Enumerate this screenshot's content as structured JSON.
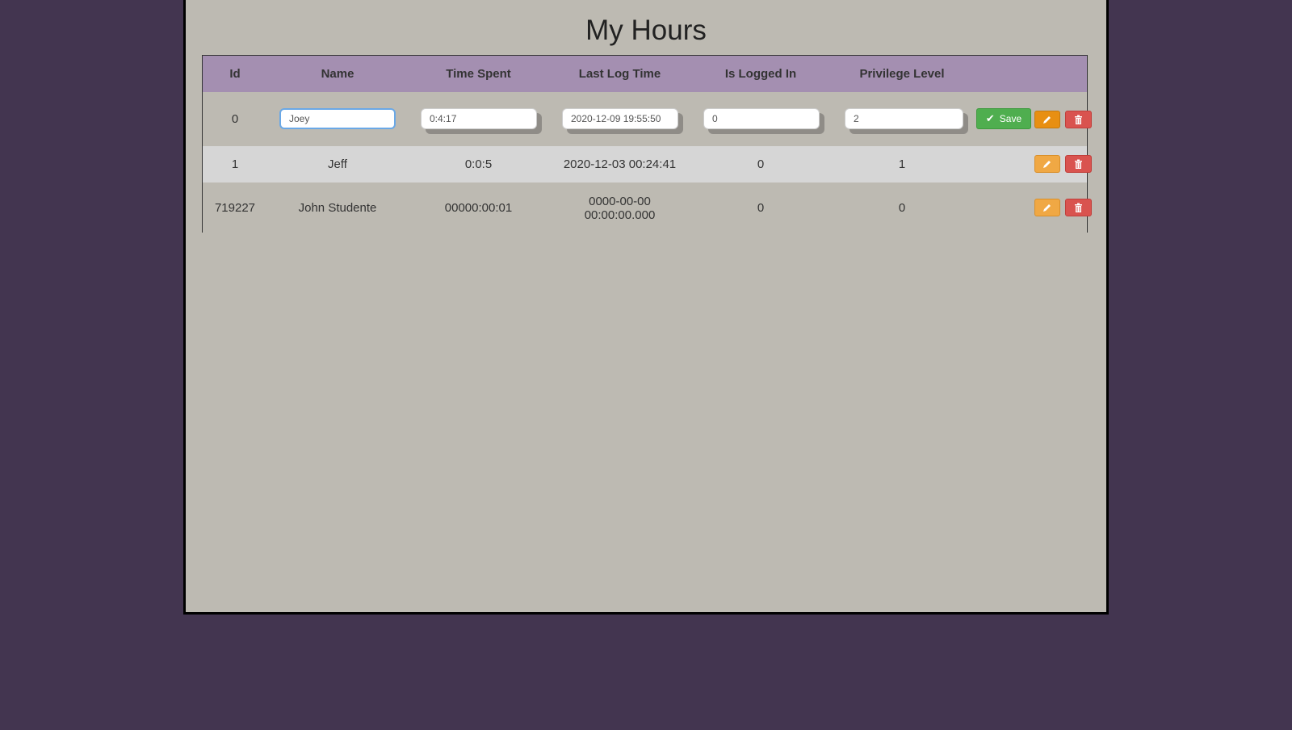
{
  "title": "My Hours",
  "columns": [
    "Id",
    "Name",
    "Time Spent",
    "Last Log Time",
    "Is Logged In",
    "Privilege Level"
  ],
  "edit_row": {
    "id": "0",
    "name": "Joey",
    "time_spent": "0:4:17",
    "last_log_time": "2020-12-09 19:55:50",
    "is_logged_in": "0",
    "privilege_level": "2",
    "save_label": "Save"
  },
  "rows": [
    {
      "id": "1",
      "name": "Jeff",
      "time_spent": "0:0:5",
      "last_log_time": "2020-12-03 00:24:41",
      "is_logged_in": "0",
      "privilege_level": "1"
    },
    {
      "id": "719227",
      "name": "John Studente",
      "time_spent": "00000:00:01",
      "last_log_time_line1": "0000-00-00",
      "last_log_time_line2": "00:00:00.000",
      "is_logged_in": "0",
      "privilege_level": "0"
    }
  ],
  "icons": {
    "save": "check-icon",
    "edit": "pencil-icon",
    "delete": "trash-icon"
  },
  "colors": {
    "background": "#433550",
    "panel": "#bdbab2",
    "header": "#a48fb1",
    "save": "#4fae4f",
    "edit": "#f0a844",
    "delete": "#d9534f"
  }
}
